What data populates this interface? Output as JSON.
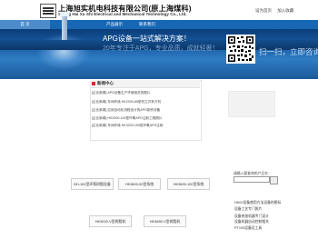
{
  "header": {
    "company_cn": "上海旭实机电科技有限公司(原上海煤科)",
    "company_en": "Shang Hai Xu Shi Electrical and Mechanical Technology Co., Ltd.",
    "links": [
      "设为首页",
      "加入收藏"
    ]
  },
  "nav": {
    "items": [
      "首 页",
      "产品展示",
      "联系我们"
    ]
  },
  "banner": {
    "slogan_main": "APG设备一站式解决方案！",
    "slogan_sub": "20年专注于APG，专业品质，成就轻奢！",
    "scan_text": "扫一扫，立即咨询！"
  },
  "news": {
    "title": "新闻中心",
    "items": [
      "[企业新闻] APG设备生产环境相关的图片",
      "[企业新闻] 车间环境 HK2000-85型机立式有方机",
      "[企业新闻] 应用自动化流程设计的APG制作设备",
      "[企业新闻] HK2000-100型环氧APG注射工程照片",
      "[企业新闻] 车间环境 HK3200-150型环氧APG注射"
    ]
  },
  "search": {
    "label": "请输入要查询的产品名："
  },
  "product_links": [
    "HK00设备使用方法设备的图标",
    "设备工艺专门照片",
    "设备参加机器专门设计",
    "设备机器自动控制相关",
    "PT100设备及工具"
  ],
  "products": [
    "BH-100型环氧树脂设备",
    "HK3600-50型系统",
    "HK3600-100型系统",
    "HK3000-V型树脂机",
    "HK3680-V型树脂机"
  ]
}
